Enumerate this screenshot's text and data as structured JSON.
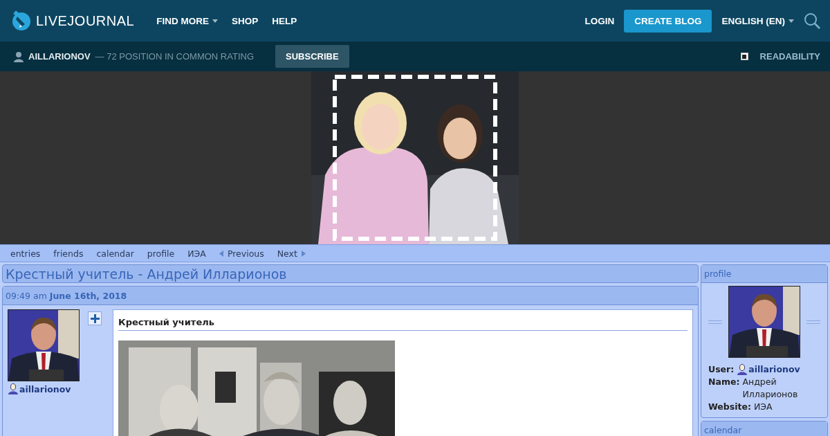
{
  "header": {
    "logo": "LIVEJOURNAL",
    "nav": [
      {
        "label": "FIND MORE",
        "dropdown": true
      },
      {
        "label": "SHOP",
        "dropdown": false
      },
      {
        "label": "HELP",
        "dropdown": false
      }
    ],
    "login": "LOGIN",
    "create_blog": "CREATE BLOG",
    "language": "ENGLISH (EN)"
  },
  "subheader": {
    "user": "AILLARIONOV",
    "rating": "— 72 POSITION IN COMMON RATING",
    "subscribe": "SUBSCRIBE",
    "readability": {
      "label": "READABILITY",
      "checked": true
    }
  },
  "nav": [
    {
      "label": "entries",
      "kind": "link"
    },
    {
      "label": "friends",
      "kind": "link"
    },
    {
      "label": "calendar",
      "kind": "link"
    },
    {
      "label": "profile",
      "kind": "link"
    },
    {
      "label": "ИЭА",
      "kind": "link"
    },
    {
      "label": "Previous",
      "kind": "prev"
    },
    {
      "label": "Next",
      "kind": "next"
    }
  ],
  "title": "Крестный учитель - Андрей Илларионов",
  "entry": {
    "time": "09:49 am",
    "date": "June 16th, 2018",
    "user": "aillarionov",
    "subject": "Крестный учитель"
  },
  "sidebar": {
    "profile": {
      "heading": "profile",
      "fields": [
        {
          "label": "User:",
          "value": "aillarionov",
          "kind": "user"
        },
        {
          "label": "Name:",
          "value": "Андрей Илларионов",
          "kind": "text"
        },
        {
          "label": "Website:",
          "value": "ИЭА",
          "kind": "text"
        }
      ]
    },
    "calendar": {
      "heading": "calendar"
    }
  }
}
